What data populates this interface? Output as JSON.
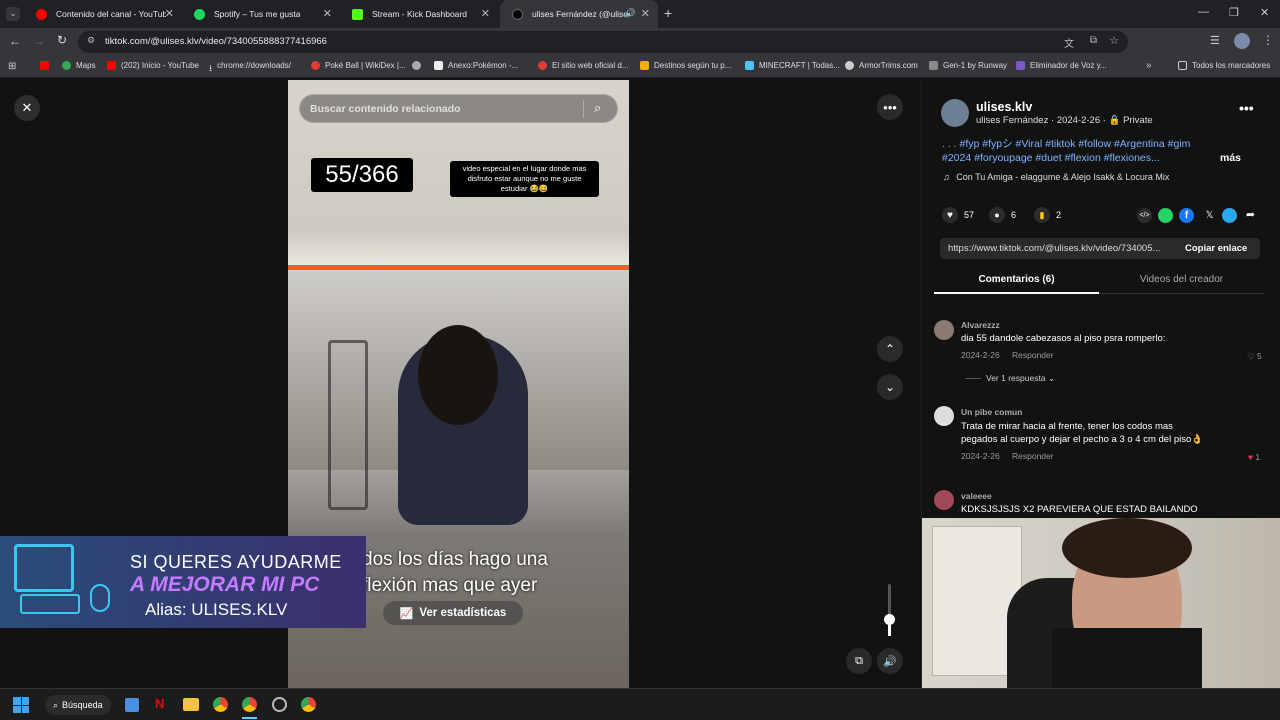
{
  "browser": {
    "tabs": [
      {
        "title": "Contenido del canal - YouTube",
        "fav_color": "#ff0000"
      },
      {
        "title": "Spotify – Tus me gusta",
        "fav_color": "#1ed760"
      },
      {
        "title": "Stream - Kick Dashboard",
        "fav_color": "#53fc18"
      },
      {
        "title": "ulises Fernández (@ulises.kl",
        "fav_color": "#000000"
      }
    ],
    "url": "tiktok.com/@ulises.klv/video/7340055888377416966",
    "bookmarks": [
      "Maps",
      "(202) Inicio - YouTube",
      "chrome://downloads/",
      "Poké Ball | WikiDex |...",
      "Anexo:Pokémon -...",
      "El sitio web oficial d...",
      "Destinos según tu p...",
      "MINECRAFT | Todas...",
      "ArmorTrims.com",
      "Gen-1 by Runway",
      "Eliminador de Voz y..."
    ],
    "all_bookmarks": "Todos los marcadores"
  },
  "video": {
    "search_placeholder": "Buscar contenido relacionado",
    "counter": "55/366",
    "caption_top": "video especial en el lugar donde mas disfruto estar aunque no me guste estudiar 😂😅",
    "subtitle_line1": "dos los días hago una",
    "subtitle_line2": "flexión mas que ayer",
    "stats_label": "Ver estadísticas"
  },
  "overlay": {
    "line1": "SI QUERES AYUDARME",
    "line2": "A MEJORAR MI PC",
    "line3": "Alias: ULISES.KLV"
  },
  "post": {
    "username": "ulises.klv",
    "display_name": "ulises Fernández",
    "date": "2024-2-26",
    "privacy": "Private",
    "caption_line1": ". . . #fyp #fypシ #Viral #tiktok #follow #Argentina #gim",
    "caption_line2": "#2024 #foryoupage #duet #flexion #flexiones...",
    "more": "más",
    "music": "Con Tu Amiga - elaggume & Alejo Isakk & Locura Mix",
    "likes": "57",
    "comments_count": "6",
    "saves": "2",
    "link": "https://www.tiktok.com/@ulises.klv/video/734005...",
    "copy_link": "Copiar enlace",
    "tab_comments": "Comentarios (6)",
    "tab_creator": "Videos del creador"
  },
  "comments": [
    {
      "name": "Alvarezzz",
      "text": "dia 55 dandole cabezasos al piso psra romperlo:",
      "date": "2024-2-26",
      "reply": "Responder",
      "likes": "5",
      "replies": "Ver 1 respuesta"
    },
    {
      "name": "Un pibe comun",
      "text1": "Trata de mirar hacia al frente, tener los codos mas",
      "text2": "pegados al cuerpo y dejar el pecho a 3 o 4 cm del piso👌",
      "date": "2024-2-26",
      "reply": "Responder",
      "likes": "1"
    },
    {
      "name": "valeeee",
      "text": "KDKSJSJSJS X2 PAREVIERA QUE ESTAD BAILANDO"
    }
  ],
  "taskbar": {
    "search": "Búsqueda"
  }
}
